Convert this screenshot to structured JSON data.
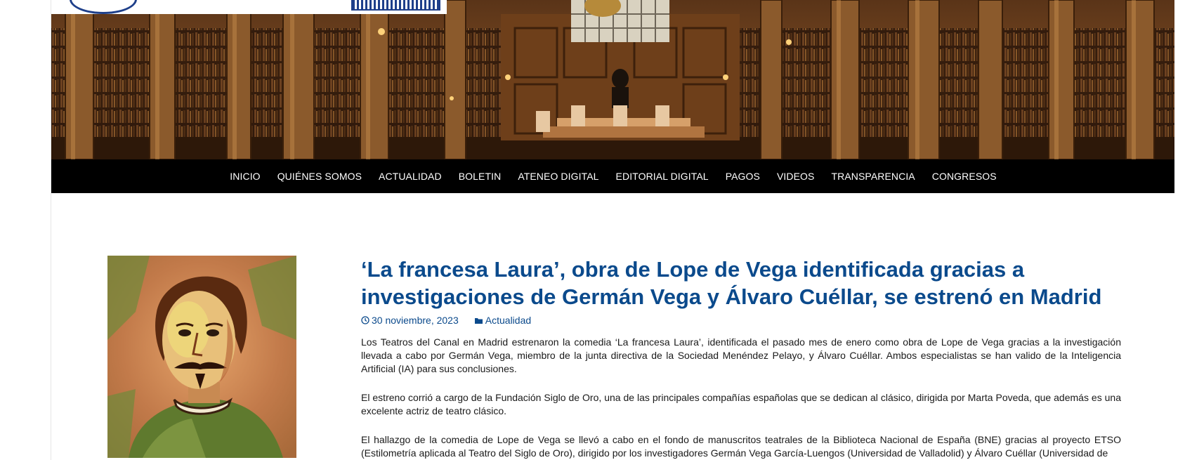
{
  "nav": {
    "items": [
      {
        "label": "INICIO"
      },
      {
        "label": "QUIÉNES SOMOS"
      },
      {
        "label": "ACTUALIDAD"
      },
      {
        "label": "BOLETIN"
      },
      {
        "label": "ATENEO DIGITAL"
      },
      {
        "label": "EDITORIAL DIGITAL"
      },
      {
        "label": "PAGOS"
      },
      {
        "label": "VIDEOS"
      },
      {
        "label": "TRANSPARENCIA"
      },
      {
        "label": "CONGRESOS"
      }
    ]
  },
  "article": {
    "title": "‘La francesa Laura’, obra de Lope de Vega identificada gracias a investigaciones de Germán Vega y Álvaro Cuéllar, se estrenó en Madrid",
    "date": "30 noviembre, 2023",
    "category": "Actualidad",
    "paragraphs": [
      "Los Teatros del Canal en Madrid estrenaron la comedia ‘La francesa Laura’, identificada el pasado mes de enero como obra de Lope de Vega gracias a la investigación llevada a cabo por Germán Vega, miembro de la junta directiva de la Sociedad Menéndez Pelayo, y Álvaro Cuéllar. Ambos especialistas se han valido de la Inteligencia Artificial (IA) para sus conclusiones.",
      "El estreno corrió a cargo de la Fundación Siglo de Oro, una de las principales compañías españolas que se dedican al clásico, dirigida por Marta Poveda, que además es una excelente actriz de teatro clásico.",
      "El hallazgo de la comedia de Lope de Vega se llevó a cabo en el fondo de manuscritos teatrales de la Biblioteca Nacional de España (BNE) gracias al proyecto ETSO (Estilometría aplicada al Teatro del Siglo de Oro), dirigido por los investigadores Germán Vega García-Luengos (Universidad de Valladolid) y Álvaro Cuéllar (Universidad de"
    ]
  },
  "colors": {
    "link": "#0b4a8c",
    "nav_bg": "#000000",
    "nav_text": "#ffffff",
    "text": "#1a1a1a"
  },
  "icons": {
    "date": "clock-icon",
    "category": "folder-icon"
  }
}
